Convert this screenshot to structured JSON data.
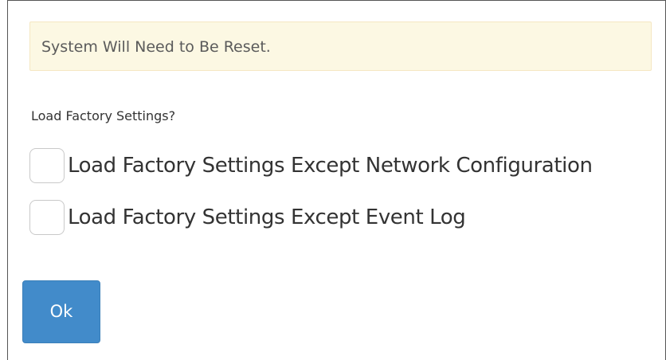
{
  "alert": {
    "message": "System Will Need to Be Reset."
  },
  "form": {
    "question": "Load Factory Settings?",
    "options": [
      {
        "label": "Load Factory Settings Except Network Configuration",
        "checked": false
      },
      {
        "label": "Load Factory Settings Except Event Log",
        "checked": false
      }
    ]
  },
  "actions": {
    "ok_label": "Ok"
  },
  "colors": {
    "alert_background": "#fcf8e3",
    "alert_border": "#f5e7c2",
    "button_primary": "#428bca",
    "text": "#333333"
  }
}
